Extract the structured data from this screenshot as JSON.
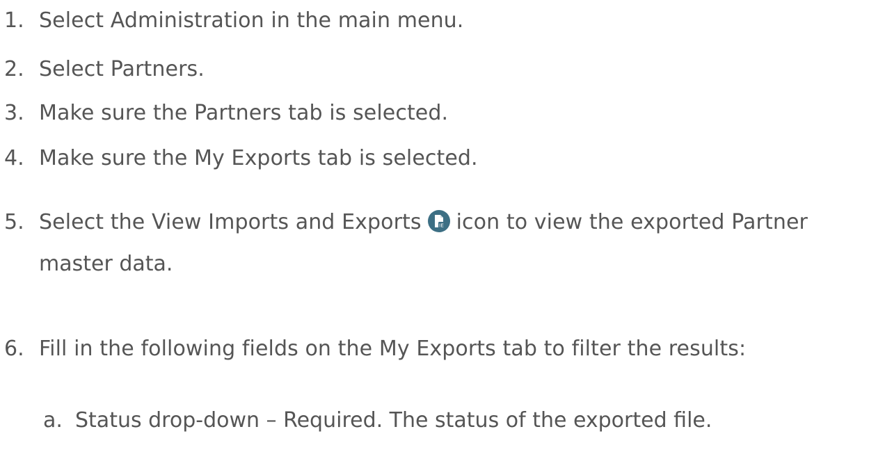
{
  "steps": [
    {
      "num": "1.",
      "text": "Select Administration in the main menu."
    },
    {
      "num": "2.",
      "text": "Select Partners."
    },
    {
      "num": "3.",
      "text": "Make sure the Partners tab is selected."
    },
    {
      "num": "4.",
      "text": "Make sure the My Exports tab is selected."
    },
    {
      "num": "5.",
      "text_before": "Select the View Imports and Exports",
      "text_after": "icon to view the exported Partner",
      "continuation": "master data.",
      "icon": "view-imports-exports-icon",
      "icon_color": "#3d6f84"
    },
    {
      "num": "6.",
      "text": "Fill in the following fields on the My Exports tab to filter the results:"
    }
  ],
  "substeps": [
    {
      "num": "a.",
      "text": "Status drop-down – Required. The status of the exported file."
    }
  ],
  "colors": {
    "text": "#555555",
    "icon_bg": "#3d6f84"
  }
}
